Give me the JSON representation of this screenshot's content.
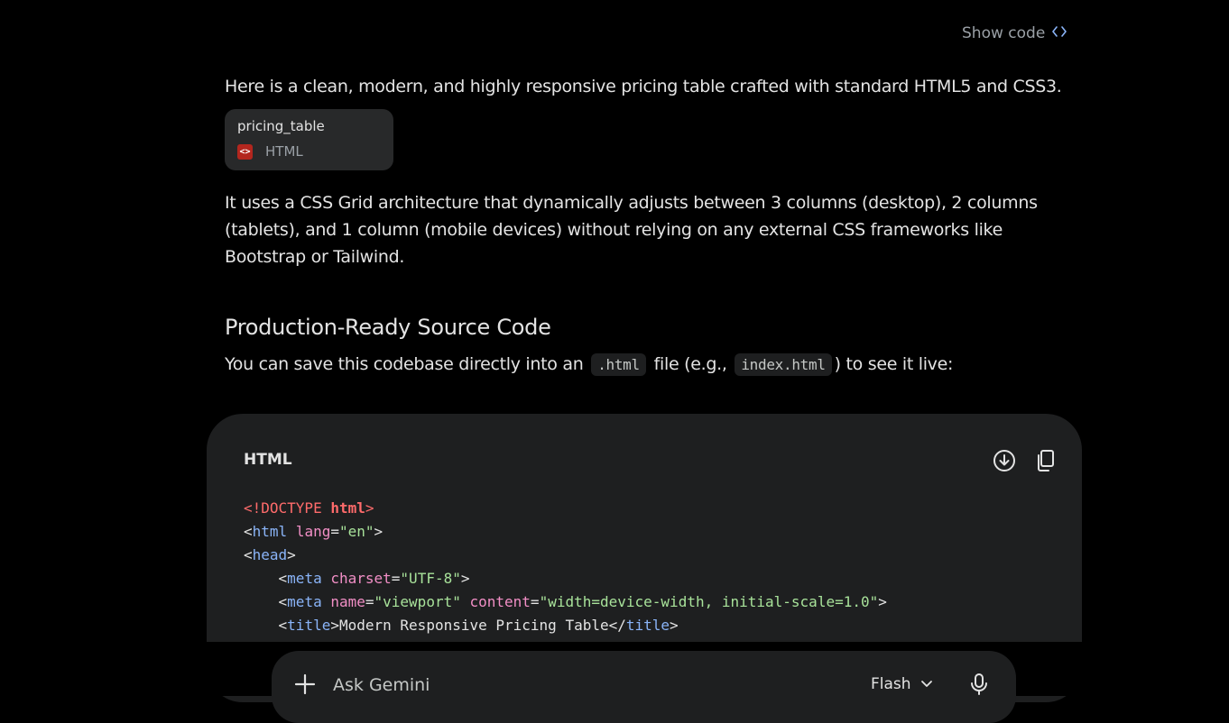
{
  "header": {
    "show_code_label": "Show code",
    "show_code_icon": "code-icon"
  },
  "response": {
    "intro": "Here is a clean, modern, and highly responsive pricing table crafted with standard HTML5 and CSS3.",
    "file_chip": {
      "name": "pricing_table",
      "type": "HTML",
      "icon": "html-file-icon"
    },
    "paragraph": "It uses a CSS Grid architecture that dynamically adjusts between 3 columns (desktop), 2 columns (tablets), and 1 column (mobile devices) without relying on any external CSS frameworks like Bootstrap or Tailwind.",
    "heading": "Production-Ready Source Code",
    "save_line": {
      "part1": "You can save this codebase directly into an",
      "code1": ".html",
      "part2": "file (e.g.,",
      "code2": "index.html",
      "part3": ") to see it live:"
    }
  },
  "code_block": {
    "language": "HTML",
    "download_icon": "download-icon",
    "copy_icon": "copy-icon",
    "lines": {
      "l1_doctype": "<!DOCTYPE ",
      "l1_html": "html",
      "l1_close": ">",
      "l2_tag": "html",
      "l2_attr": "lang",
      "l2_val": "\"en\"",
      "l3_tag": "head",
      "l4_tag": "meta",
      "l4_attr": "charset",
      "l4_val": "\"UTF-8\"",
      "l5_tag": "meta",
      "l5_attr1": "name",
      "l5_val1": "\"viewport\"",
      "l5_attr2": "content",
      "l5_val2": "\"width=device-width, initial-scale=1.0\"",
      "l6_tag": "title",
      "l6_text": "Modern Responsive Pricing Table",
      "l6_endtag": "title"
    }
  },
  "input_bar": {
    "placeholder": "Ask Gemini",
    "model_label": "Flash",
    "plus_icon": "plus-icon",
    "mic_icon": "mic-icon",
    "chevron_icon": "chevron-down-icon"
  },
  "colors": {
    "background": "#000000",
    "surface": "#1e1f20",
    "chip": "#28292a",
    "accent": "#8ab4f8",
    "html_icon": "#b3261e"
  }
}
